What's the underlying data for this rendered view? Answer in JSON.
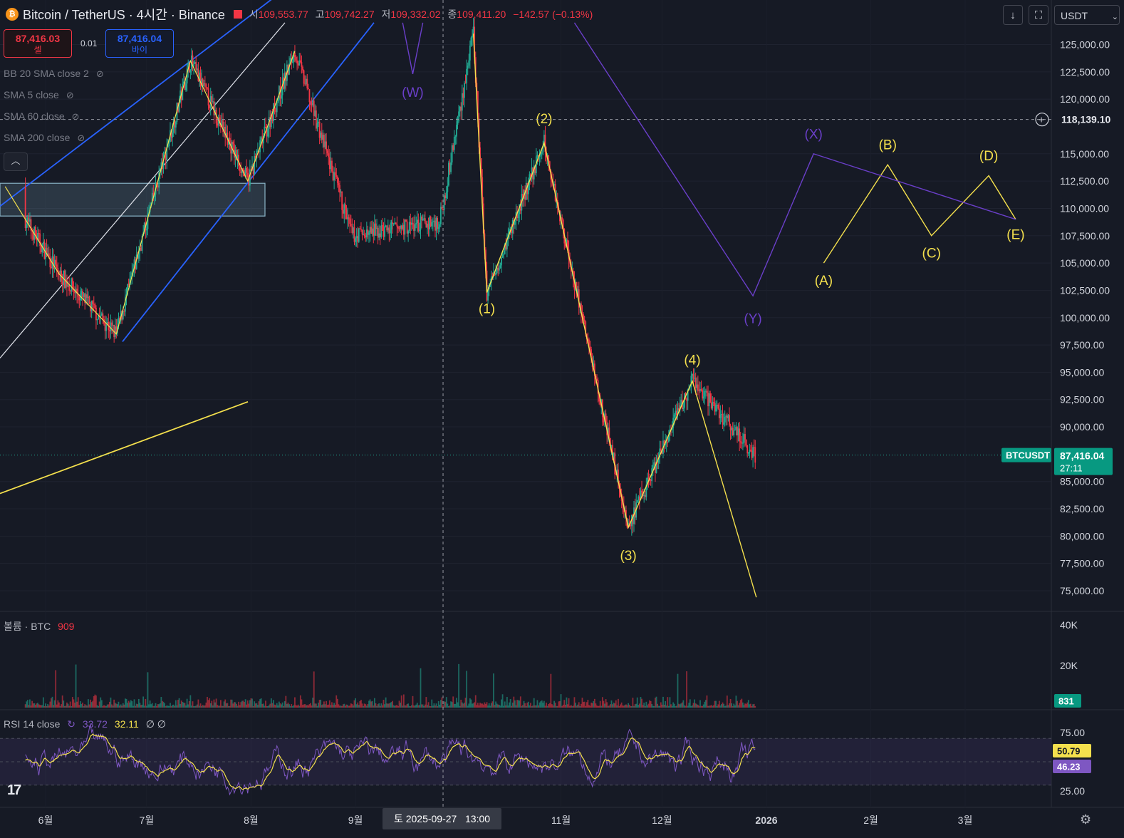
{
  "header": {
    "symbol_title": "Bitcoin / TetherUS · 4시간 · Binance",
    "open_label": "시",
    "open": "109,553.77",
    "high_label": "고",
    "high": "109,742.27",
    "low_label": "저",
    "low": "109,332.02",
    "close_label": "종",
    "close": "109,411.20",
    "change": "−142.57 (−0.13%)"
  },
  "trade": {
    "sell_price": "87,416.03",
    "sell_label": "셀",
    "spread": "0.01",
    "buy_price": "87,416.04",
    "buy_label": "바이"
  },
  "indicators": [
    "BB 20 SMA close 2",
    "SMA 5 close",
    "SMA 60 close",
    "SMA 200 close"
  ],
  "toolbar": {
    "currency": "USDT"
  },
  "colors": {
    "bg": "#161a25",
    "up": "#22ab94",
    "down": "#f23645",
    "wave_yellow": "#f4e04d",
    "wave_orange": "#f39c12",
    "wave_purple": "#6a3fc9",
    "channel_blue": "#2962ff"
  },
  "chart_data": [
    {
      "type": "candlestick",
      "title": "Bitcoin / TetherUS · 4시간 · Binance",
      "ylim": [
        73500,
        126500
      ],
      "yticks": [
        "125,000.00",
        "122,500.00",
        "120,000.00",
        "115,000.00",
        "112,500.00",
        "110,000.00",
        "107,500.00",
        "105,000.00",
        "102,500.00",
        "100,000.00",
        "97,500.00",
        "95,000.00",
        "92,500.00",
        "90,000.00",
        "85,000.00",
        "82,500.00",
        "80,000.00",
        "77,500.00",
        "75,000.00"
      ],
      "xticks": [
        "6월",
        "7월",
        "8월",
        "9월",
        "11월",
        "12월",
        "2026",
        "2월",
        "3월"
      ],
      "crosshair_price": "118,139.10",
      "crosshair_date": "토 2025-09-27",
      "crosshair_time": "13:00",
      "last_price": {
        "symbol": "BTCUSDT",
        "price": "87,416.04",
        "countdown": "27:11"
      },
      "wave_path_approx": [
        [
          "2025-05-20",
          112000
        ],
        [
          "2025-06-05",
          104000
        ],
        [
          "2025-06-22",
          98500
        ],
        [
          "2025-07-14",
          123500
        ],
        [
          "2025-07-31",
          112500
        ],
        [
          "2025-08-14",
          124400
        ],
        [
          "2025-08-31",
          107500
        ],
        [
          "2025-09-26",
          108800
        ],
        [
          "2025-10-06",
          126000
        ],
        [
          "2025-10-10",
          102300
        ],
        [
          "2025-10-27",
          116000
        ],
        [
          "2025-11-21",
          80800
        ],
        [
          "2025-12-10",
          94200
        ],
        [
          "2025-12-29",
          87400
        ]
      ],
      "wave_labels": {
        "yellow": [
          "(1)",
          "(2)",
          "(3)",
          "(4)",
          "(A)",
          "(B)",
          "(C)",
          "(D)",
          "(E)"
        ],
        "purple": [
          "(W)",
          "(X)",
          "(Y)"
        ]
      },
      "projection": {
        "yellow": [
          [
            "2026-01-18",
            105000
          ],
          [
            "2026-02-06",
            114000
          ],
          [
            "2026-02-19",
            107500
          ],
          [
            "2026-03-08",
            113000
          ],
          [
            "2026-03-16",
            109000
          ]
        ],
        "purple": [
          [
            "2025-12-28",
            102000
          ],
          [
            "2026-01-15",
            115000
          ],
          [
            "2026-03-16",
            109000
          ]
        ]
      }
    },
    {
      "type": "bar",
      "title": "볼륨 · BTC",
      "last_value": "909",
      "yticks": [
        "40K",
        "20K"
      ],
      "current_tag": "831"
    },
    {
      "type": "line",
      "title": "RSI 14 close",
      "series": [
        {
          "name": "RSI",
          "last": "33.72"
        },
        {
          "name": "MA",
          "last": "32.11"
        }
      ],
      "suffix": "∅ ∅",
      "yticks": [
        "75.00",
        "25.00"
      ],
      "tags": [
        "50.79",
        "46.23"
      ],
      "ylim": [
        25,
        75
      ]
    }
  ]
}
